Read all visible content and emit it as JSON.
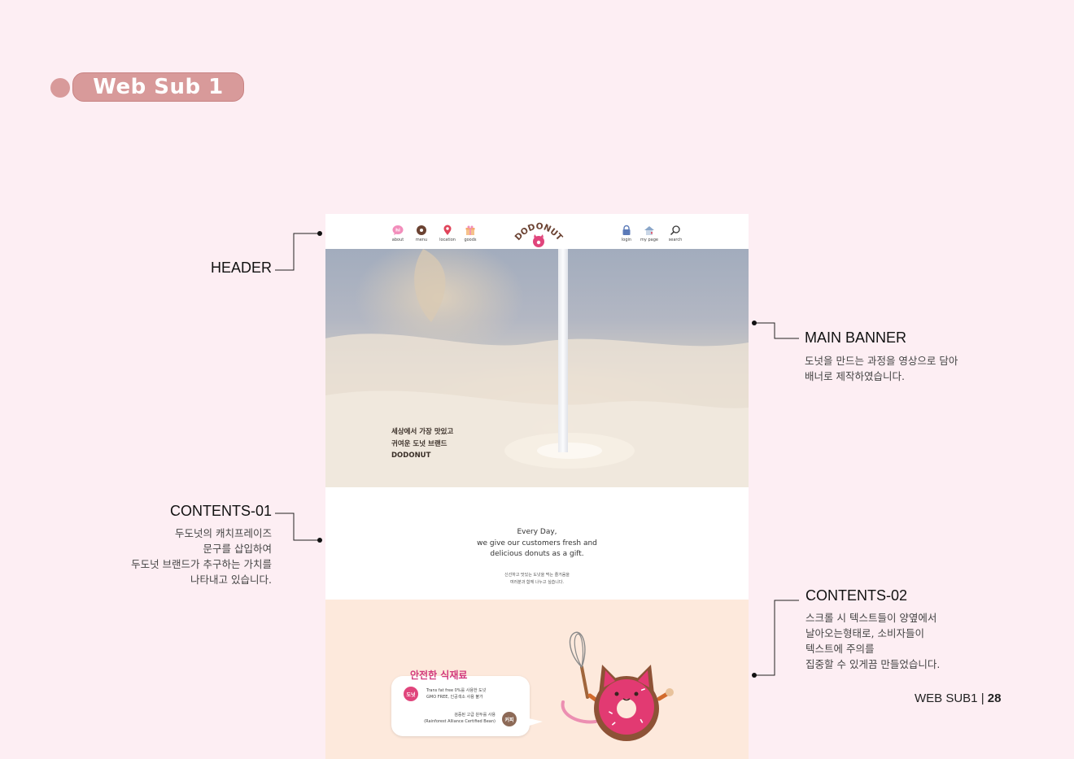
{
  "page": {
    "badge_label": "Web Sub 1",
    "footer": {
      "label": "WEB SUB1",
      "separator": "|",
      "page_number": "28"
    }
  },
  "annotations": {
    "header": {
      "title": "HEADER"
    },
    "main_banner": {
      "title": "MAIN BANNER",
      "lines": [
        "도넛을 만드는 과정을 영상으로 담아",
        "배너로 제작하였습니다."
      ]
    },
    "contents_01": {
      "title": "CONTENTS-01",
      "lines": [
        "두도넛의 캐치프레이즈",
        "문구를 삽입하여",
        "두도넛 브랜드가 추구하는 가치를",
        "나타내고 있습니다."
      ]
    },
    "contents_02": {
      "title": "CONTENTS-02",
      "lines": [
        "스크롤 시 텍스트들이 양옆에서",
        "날아오는형태로, 소비자들이",
        "텍스트에 주의를",
        "집중할 수 있게끔 만들었습니다."
      ]
    }
  },
  "mockup": {
    "nav_left": [
      {
        "label": "about",
        "icon": "hi-bubble-icon"
      },
      {
        "label": "menu",
        "icon": "donut-icon"
      },
      {
        "label": "location",
        "icon": "map-pin-icon"
      },
      {
        "label": "goods",
        "icon": "gift-box-icon"
      }
    ],
    "logo_text": "DODONUT",
    "nav_right": [
      {
        "label": "login",
        "icon": "lock-icon"
      },
      {
        "label": "my page",
        "icon": "house-heart-icon"
      },
      {
        "label": "search",
        "icon": "search-icon"
      }
    ],
    "banner": {
      "lines": [
        "세상에서 가장 맛있고",
        "귀여운 도넛 브랜드",
        "DODONUT"
      ]
    },
    "contents_01": {
      "en_lines": [
        "Every Day,",
        "we give our customers fresh and",
        "delicious donuts as a gift."
      ],
      "ko_lines": [
        "신선하고 맛있는 도넛을 먹는 즐거움을",
        "여러분과 함께 나누고 싶습니다."
      ]
    },
    "contents_02": {
      "title": "안전한 식재료",
      "item1": {
        "chip": "도넛",
        "lines": [
          "Trans fat free 0%를 사용한 도넛",
          "GMO FREE, 인공색소 사용 불가"
        ]
      },
      "item2": {
        "chip": "커피",
        "lines": [
          "검증된 고급 원두를 사용",
          "(Rainforest Alliance Certified Bean)"
        ]
      }
    }
  },
  "colors": {
    "page_bg": "#fdeef3",
    "badge": "#d89a9a",
    "brand_pink": "#d23a7e",
    "brand_brown": "#6b4232",
    "contents02_bg": "#fde9dc"
  }
}
